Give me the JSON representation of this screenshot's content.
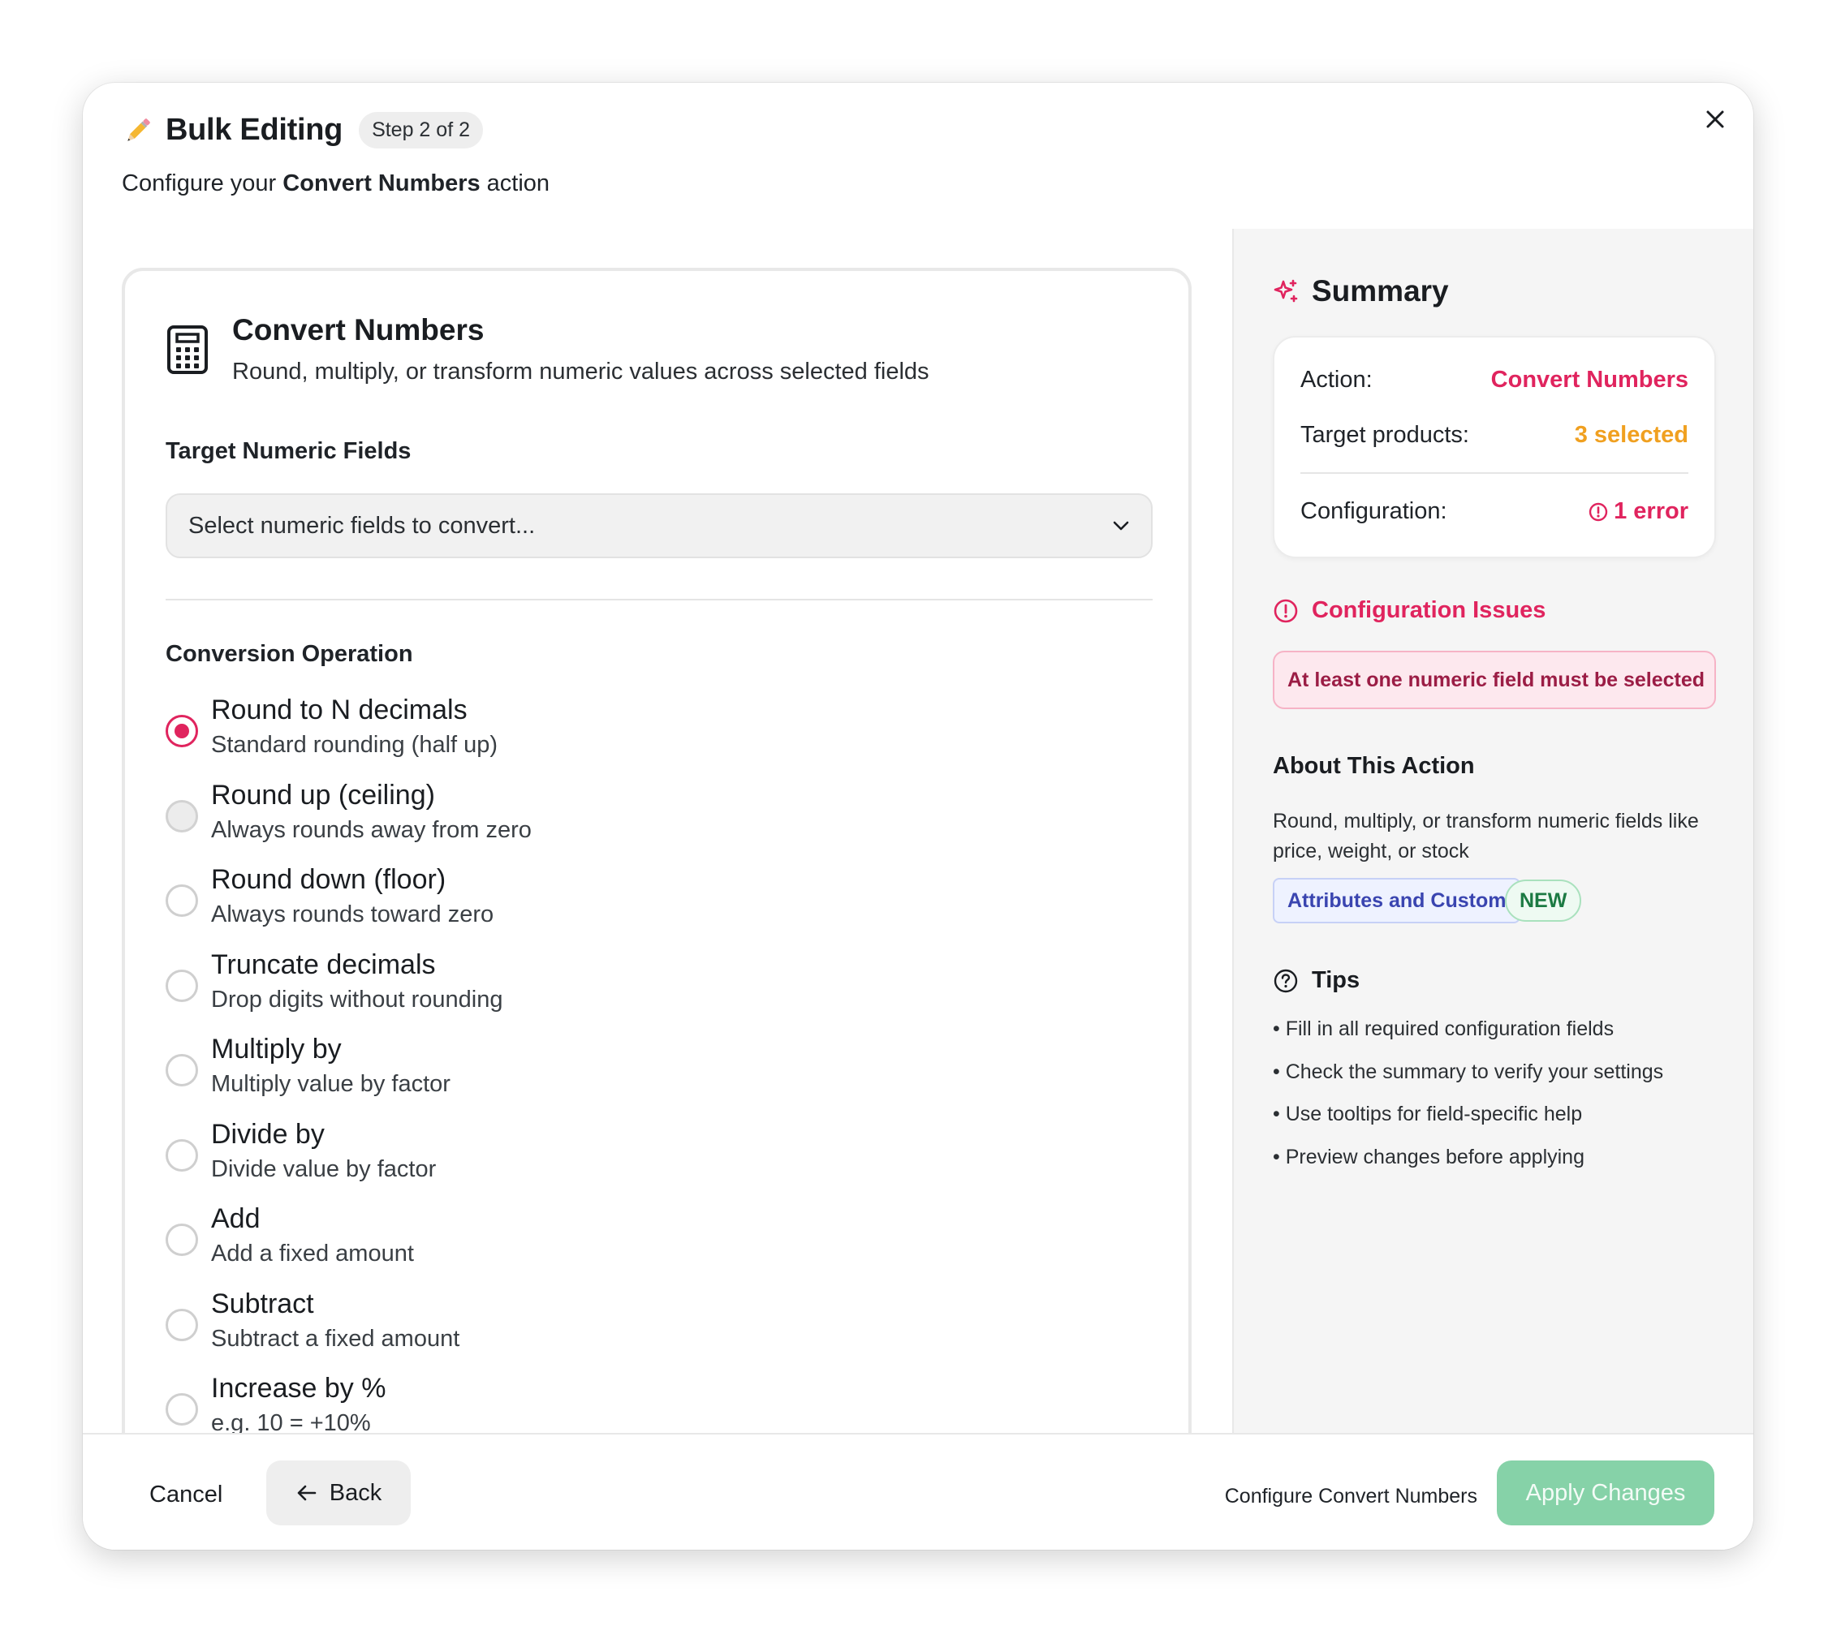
{
  "header": {
    "title": "Bulk Editing",
    "step": "Step 2 of 2",
    "subtitle_prefix": "Configure your",
    "subtitle_action": "Convert Numbers",
    "subtitle_suffix": "action"
  },
  "card": {
    "title": "Convert Numbers",
    "description": "Round, multiply, or transform numeric values across selected fields",
    "target_label": "Target Numeric Fields",
    "select_placeholder": "Select numeric fields to convert...",
    "operation_label": "Conversion Operation",
    "options": [
      {
        "label": "Round to N decimals",
        "desc": "Standard rounding (half up)",
        "selected": true
      },
      {
        "label": "Round up (ceiling)",
        "desc": "Always rounds away from zero",
        "selected": false
      },
      {
        "label": "Round down (floor)",
        "desc": "Always rounds toward zero",
        "selected": false
      },
      {
        "label": "Truncate decimals",
        "desc": "Drop digits without rounding",
        "selected": false
      },
      {
        "label": "Multiply by",
        "desc": "Multiply value by factor",
        "selected": false
      },
      {
        "label": "Divide by",
        "desc": "Divide value by factor",
        "selected": false
      },
      {
        "label": "Add",
        "desc": "Add a fixed amount",
        "selected": false
      },
      {
        "label": "Subtract",
        "desc": "Subtract a fixed amount",
        "selected": false
      },
      {
        "label": "Increase by %",
        "desc": "e.g. 10 = +10%",
        "selected": false
      }
    ]
  },
  "summary": {
    "title": "Summary",
    "action_key": "Action:",
    "action_value": "Convert Numbers",
    "target_key": "Target products:",
    "target_value": "3 selected",
    "config_key": "Configuration:",
    "config_value": "1 error",
    "issues_title": "Configuration Issues",
    "issue_message": "At least one numeric field must be selected",
    "about_title": "About This Action",
    "about_text": "Round, multiply, or transform numeric fields like price, weight, or stock",
    "tag_category": "Attributes and Custom",
    "tag_new": "NEW",
    "tips_title": "Tips",
    "tips": [
      "• Fill in all required configuration fields",
      "• Check the summary to verify your settings",
      "• Use tooltips for field-specific help",
      "• Preview changes before applying"
    ]
  },
  "footer": {
    "cancel": "Cancel",
    "back": "Back",
    "hint": "Configure Convert Numbers",
    "apply": "Apply Changes"
  },
  "colors": {
    "accent_pink": "#e0245e",
    "accent_orange": "#f0a020",
    "apply_green": "#86d2a8"
  }
}
